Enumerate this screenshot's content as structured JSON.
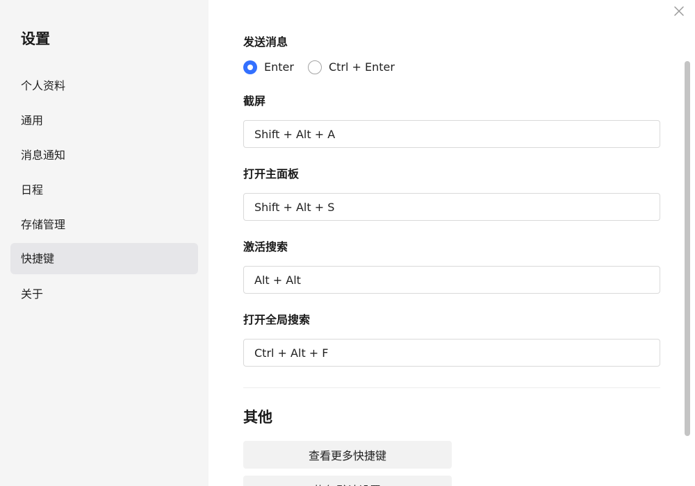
{
  "sidebar": {
    "title": "设置",
    "items": [
      {
        "label": "个人资料"
      },
      {
        "label": "通用"
      },
      {
        "label": "消息通知"
      },
      {
        "label": "日程"
      },
      {
        "label": "存储管理"
      },
      {
        "label": "快捷键",
        "active": true
      },
      {
        "label": "关于"
      }
    ]
  },
  "main": {
    "send_message": {
      "label": "发送消息",
      "options": [
        {
          "label": "Enter",
          "checked": true
        },
        {
          "label": "Ctrl + Enter",
          "checked": false
        }
      ]
    },
    "shortcuts": [
      {
        "label": "截屏",
        "value": "Shift + Alt + A"
      },
      {
        "label": "打开主面板",
        "value": "Shift + Alt + S"
      },
      {
        "label": "激活搜索",
        "value": "Alt + Alt"
      },
      {
        "label": "打开全局搜索",
        "value": "Ctrl + Alt + F"
      }
    ],
    "other": {
      "title": "其他",
      "buttons": [
        {
          "label": "查看更多快捷键"
        },
        {
          "label": "恢复默认设置"
        }
      ]
    }
  },
  "icons": {
    "close": "close-icon"
  },
  "colors": {
    "accent": "#3370ff",
    "sidebar_bg": "#f5f5f5",
    "active_item_bg": "#e6e6e9",
    "button_bg": "#f2f2f2",
    "input_border": "#d9d9d9"
  }
}
